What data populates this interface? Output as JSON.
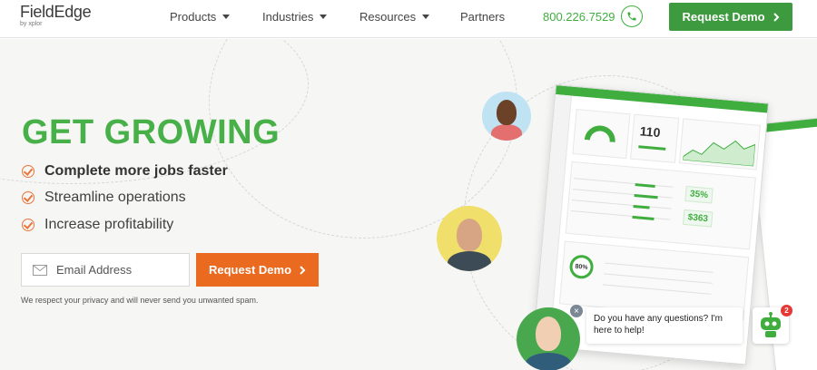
{
  "header": {
    "logo": {
      "brand": "FieldEdge",
      "byline": "by xplor"
    },
    "nav": [
      {
        "label": "Products",
        "has_caret": true
      },
      {
        "label": "Industries",
        "has_caret": true
      },
      {
        "label": "Resources",
        "has_caret": true
      },
      {
        "label": "Partners",
        "has_caret": false
      }
    ],
    "phone": "800.226.7529",
    "cta_label": "Request Demo"
  },
  "hero": {
    "headline": "GET GROWING",
    "bullets": [
      "Complete more jobs faster",
      "Streamline operations",
      "Increase profitability"
    ],
    "email_placeholder": "Email Address",
    "cta_label": "Request Demo",
    "privacy": "We respect your privacy and will never send you unwanted spam."
  },
  "dashboard": {
    "kpi_main": "110",
    "pct_a": "35%",
    "amount": "$363",
    "ring": "80%"
  },
  "chat": {
    "message": "Do you have any questions? I'm here to help!",
    "badge_count": "2"
  },
  "colors": {
    "brand_green": "#3fae3f",
    "cta_green": "#3d9a3f",
    "accent_orange": "#ea6a1f",
    "headline_green": "#48b048"
  },
  "icons": [
    "caret-down-icon",
    "phone-icon",
    "chevron-right-icon",
    "check-circle-icon",
    "mail-icon",
    "close-icon",
    "chatbot-icon"
  ]
}
